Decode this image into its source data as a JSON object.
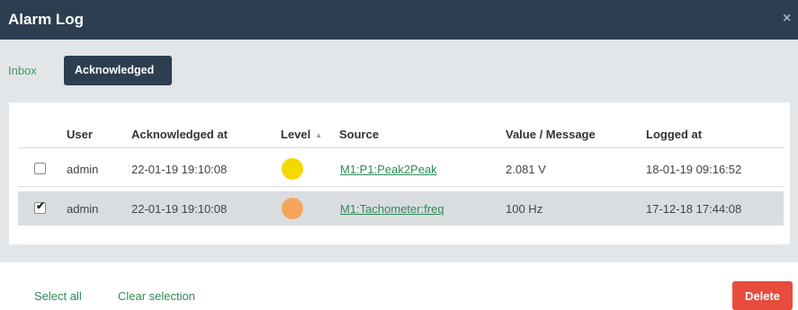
{
  "dialog": {
    "title": "Alarm Log",
    "close_icon": "×"
  },
  "tabs": [
    {
      "label": "Inbox",
      "active": false
    },
    {
      "label": "Acknowledged",
      "active": true
    }
  ],
  "table": {
    "headers": {
      "user": "User",
      "acknowledged_at": "Acknowledged at",
      "level": "Level",
      "level_sort_icon": "▲",
      "source": "Source",
      "value_message": "Value / Message",
      "logged_at": "Logged at"
    },
    "rows": [
      {
        "checked": false,
        "user": "admin",
        "acknowledged_at": "22-01-19 19:10:08",
        "level_color": "#f5d800",
        "source": "M1:P1:Peak2Peak",
        "value": "2.081 V",
        "logged_at": "18-01-19 09:16:52"
      },
      {
        "checked": true,
        "check_mark": "✔",
        "user": "admin",
        "acknowledged_at": "22-01-19 19:10:08",
        "level_color": "#f5a55a",
        "source": "M1:Tachometer:freq",
        "value": "100 Hz",
        "logged_at": "17-12-18 17:44:08"
      }
    ]
  },
  "footer": {
    "select_all": "Select all",
    "clear_selection": "Clear selection",
    "delete": "Delete"
  },
  "colors": {
    "header_bg": "#2c3e50",
    "panel_bg": "#e3e6e8",
    "accent_green": "#2e8b57",
    "delete_red": "#e74c3c"
  }
}
